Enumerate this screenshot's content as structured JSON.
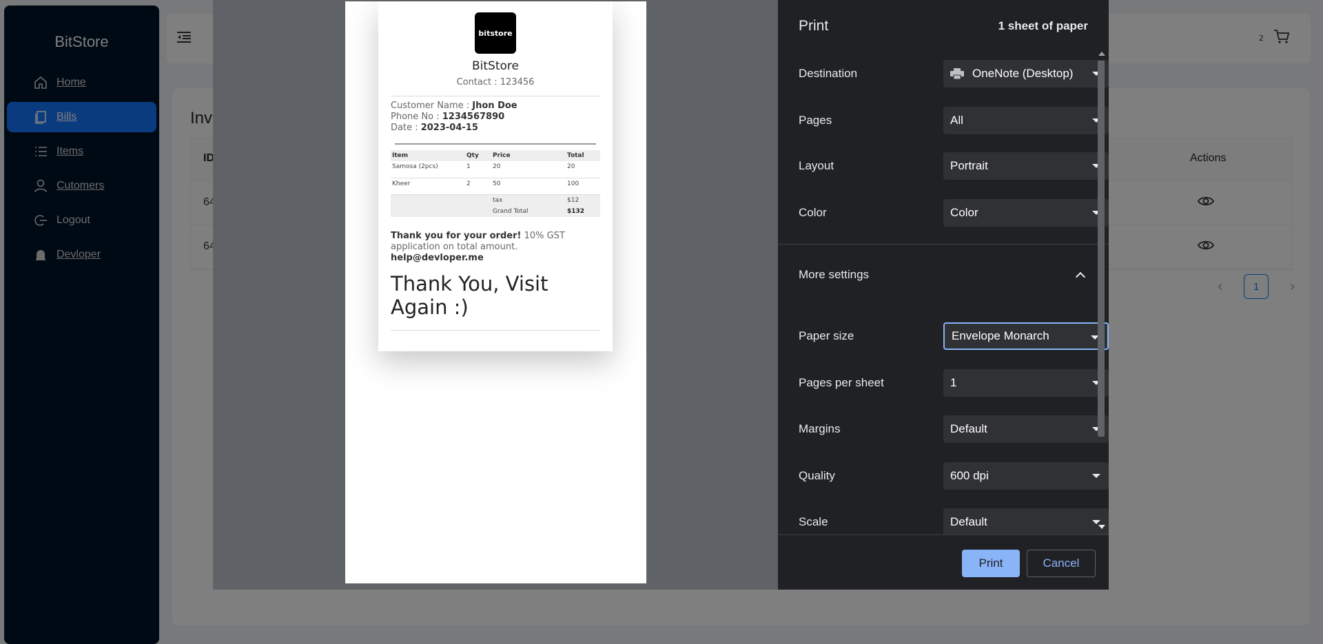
{
  "sidebar": {
    "brand": "BitStore",
    "items": [
      {
        "label": "Home",
        "icon": "home-icon"
      },
      {
        "label": "Bills",
        "icon": "bills-icon"
      },
      {
        "label": "Items",
        "icon": "list-icon"
      },
      {
        "label": "Cutomers",
        "icon": "user-icon"
      },
      {
        "label": "Logout",
        "icon": "logout-icon"
      },
      {
        "label": "Devloper",
        "icon": "bell-icon"
      }
    ]
  },
  "header": {
    "cart_count": "2"
  },
  "main": {
    "title": "Inv",
    "table": {
      "columns": {
        "id": "ID",
        "actions": "Actions"
      },
      "rows": [
        {
          "id": "64"
        },
        {
          "id": "64"
        }
      ]
    },
    "pagination": {
      "current": "1"
    }
  },
  "receipt": {
    "logo_text": "bitstore",
    "title": "BitStore",
    "contact": "Contact : 123456",
    "customer_label": "Customer Name : ",
    "customer_value": "Jhon Doe",
    "phone_label": "Phone No : ",
    "phone_value": "1234567890",
    "date_label": "Date : ",
    "date_value": "2023-04-15",
    "columns": [
      "Item",
      "Qty",
      "Price",
      "Total"
    ],
    "items": [
      {
        "name": "Samosa (2pcs)",
        "qty": "1",
        "price": "20",
        "total": "20"
      },
      {
        "name": "Kheer",
        "qty": "2",
        "price": "50",
        "total": "100"
      }
    ],
    "tax_label": "tax",
    "tax_value": "$12",
    "grand_label": "Grand Total",
    "grand_value": "$132",
    "thanks_bold": "Thank you for your order!",
    "thanks_text": " 10% GST application on total amount.",
    "email": "help@devloper.me",
    "big_text": "Thank You, Visit Again :)"
  },
  "print": {
    "title": "Print",
    "sheet_count": "1 sheet of paper",
    "destination": {
      "label": "Destination",
      "value": "OneNote (Desktop)"
    },
    "pages": {
      "label": "Pages",
      "value": "All"
    },
    "layout": {
      "label": "Layout",
      "value": "Portrait"
    },
    "color": {
      "label": "Color",
      "value": "Color"
    },
    "more_settings": "More settings",
    "paper_size": {
      "label": "Paper size",
      "value": "Envelope Monarch"
    },
    "pages_per_sheet": {
      "label": "Pages per sheet",
      "value": "1"
    },
    "margins": {
      "label": "Margins",
      "value": "Default"
    },
    "quality": {
      "label": "Quality",
      "value": "600 dpi"
    },
    "scale": {
      "label": "Scale",
      "value": "Default"
    },
    "print_button": "Print",
    "cancel_button": "Cancel"
  },
  "colors": {
    "sidebar_bg": "#001529",
    "active_item": "#1677ff",
    "dialog_panel": "#202124",
    "accent_blue": "#8ab4f8"
  }
}
